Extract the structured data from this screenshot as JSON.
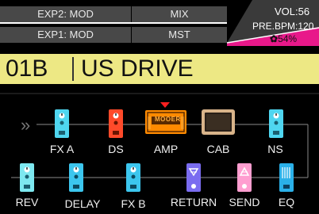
{
  "header": {
    "exp2": "EXP2: MOD",
    "exp1": "EXP1: MOD",
    "mix": "MIX",
    "mst": "MST",
    "vol": "VOL:56",
    "bpm": "PRE.BPM:120",
    "battery": "54%",
    "colors": {
      "accent": "#e8188a",
      "cell": "#484848"
    }
  },
  "patch": {
    "number": "01B",
    "name": "US DRIVE",
    "bar_color": "#ede884"
  },
  "chain": {
    "start_marker": "»",
    "row1": [
      {
        "label": "FX A",
        "color": "#4fd6f0",
        "icon": "pedal-icon"
      },
      {
        "label": "DS",
        "color": "#ff4a2a",
        "icon": "pedal-icon"
      },
      {
        "label": "AMP",
        "color": "#ff8a00",
        "icon": "amp-head-icon",
        "brand": "MOOER",
        "selected": true
      },
      {
        "label": "CAB",
        "color": "#d9b48a",
        "icon": "cabinet-icon"
      },
      {
        "label": "NS",
        "color": "#4fd6f0",
        "icon": "pedal-icon"
      }
    ],
    "row2": [
      {
        "label": "REV",
        "color": "#7de8f0",
        "icon": "pedal-icon"
      },
      {
        "label": "DELAY",
        "color": "#3cc6ee",
        "icon": "pedal-icon"
      },
      {
        "label": "FX B",
        "color": "#3cc6ee",
        "icon": "pedal-icon"
      },
      {
        "label": "RETURN",
        "color": "#7a6cf0",
        "icon": "return-icon"
      },
      {
        "label": "SEND",
        "color": "#ff9ed0",
        "icon": "send-icon"
      },
      {
        "label": "EQ",
        "color": "#2ab0e8",
        "icon": "eq-icon"
      }
    ]
  }
}
